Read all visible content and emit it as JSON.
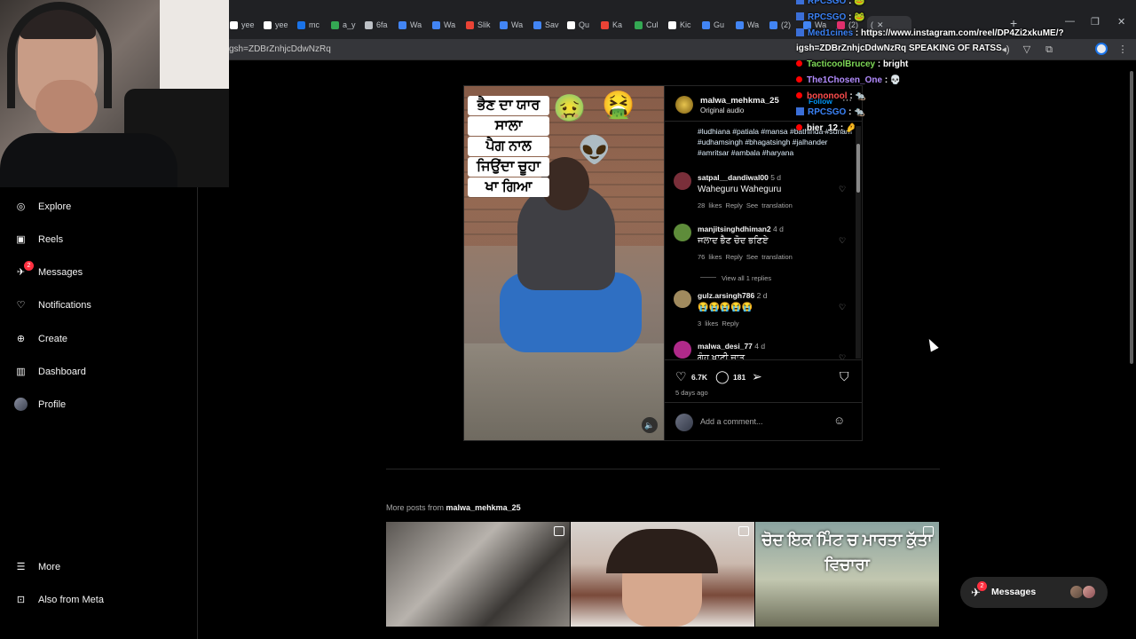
{
  "browser": {
    "tabs": [
      {
        "label": "yee",
        "color": "#ffffff"
      },
      {
        "label": "yee",
        "color": "#ffffff"
      },
      {
        "label": "mc",
        "color": "#1a73e8"
      },
      {
        "label": "a_y",
        "color": "#34a853"
      },
      {
        "label": "6fa",
        "color": "#bdc1c6"
      },
      {
        "label": "Wa",
        "color": "#4285f4"
      },
      {
        "label": "Wa",
        "color": "#4285f4"
      },
      {
        "label": "Slik",
        "color": "#ea4335"
      },
      {
        "label": "Wa",
        "color": "#4285f4"
      },
      {
        "label": "Sav",
        "color": "#4285f4"
      },
      {
        "label": "Qu",
        "color": "#ffffff"
      },
      {
        "label": "Ka",
        "color": "#ea4335"
      },
      {
        "label": "Cul",
        "color": "#34a853"
      },
      {
        "label": "Kic",
        "color": "#ffffff"
      },
      {
        "label": "Gu",
        "color": "#4285f4"
      },
      {
        "label": "Wa",
        "color": "#4285f4"
      },
      {
        "label": "(2)",
        "color": "#4285f4"
      },
      {
        "label": "Wa",
        "color": "#4285f4"
      },
      {
        "label": "(2)",
        "color": "#e1306c"
      }
    ],
    "active_tab_label": "(",
    "url": "gsh=ZDBrZnhjcDdwNzRq"
  },
  "nav": {
    "items": [
      {
        "label": "Explore",
        "icon": "compass-icon",
        "glyph": "◎"
      },
      {
        "label": "Reels",
        "icon": "reels-icon",
        "glyph": "▣"
      },
      {
        "label": "Messages",
        "icon": "messenger-icon",
        "glyph": "✈",
        "badge": "2"
      },
      {
        "label": "Notifications",
        "icon": "heart-icon",
        "glyph": "♡"
      },
      {
        "label": "Create",
        "icon": "plus-square-icon",
        "glyph": "⊕"
      },
      {
        "label": "Dashboard",
        "icon": "chart-icon",
        "glyph": "▥"
      },
      {
        "label": "Profile",
        "icon": "avatar-icon",
        "glyph": ""
      }
    ],
    "bottom": [
      {
        "label": "More",
        "icon": "menu-icon",
        "glyph": "☰"
      },
      {
        "label": "Also from Meta",
        "icon": "meta-icon",
        "glyph": "⊡"
      }
    ]
  },
  "post": {
    "username": "malwa_mehkma_25",
    "audio": "Original audio",
    "follow": "Follow",
    "media_caption": [
      "ਭੈਣ ਦਾ ਯਾਰ",
      "ਸਾਲਾ",
      "ਪੈਗ ਨਾਲ",
      "ਜਿਉਂਦਾ ਚੂਹਾ",
      "ਖਾ ਗਿਆ"
    ],
    "hashtags": "#ludhiana #patiala #mansa #bathinda #sunam #udhamsingh #bhagatsingh #jalhander #amritsar #ambala #haryana",
    "comments": [
      {
        "user": "satpal__dandiwal00",
        "age": "5 d",
        "text": "Waheguru Waheguru",
        "likes": "28 likes",
        "reply": "Reply",
        "translate": "See translation",
        "color": "#7a2f3a"
      },
      {
        "user": "manjitsinghdhiman2",
        "age": "4 d",
        "text": "ਜਲਾਦ ਭੈਣ ਚੋਦ ਭਣਿਏ",
        "likes": "76 likes",
        "reply": "Reply",
        "translate": "See translation",
        "color": "#5e8c3a"
      },
      {
        "user": "gulz.arsingh786",
        "age": "2 d",
        "text": "😭😭😭😭😭",
        "likes": "3 likes",
        "reply": "Reply",
        "translate": "",
        "color": "#a08a5e"
      },
      {
        "user": "malwa_desi_77",
        "age": "4 d",
        "text": "ਗੰਹ ਖਾਣੀ ਜਾਤ",
        "likes": "",
        "reply": "",
        "translate": "",
        "color": "#b02a8a"
      }
    ],
    "view_replies": "View all 1 replies",
    "like_count": "6.7K",
    "comment_count": "181",
    "date": "5 days ago",
    "add_comment_placeholder": "Add a comment..."
  },
  "more_posts": {
    "prefix": "More posts from",
    "user": "malwa_mehkma_25",
    "thumb3_caption": "ਚੋਦ ਇਕ ਮਿੰਟ ਚ ਮਾਰਤਾ ਕੁੱਤਾ ਵਿਚਾਰਾ"
  },
  "messages_pill": {
    "label": "Messages",
    "badge": "2"
  },
  "chat": [
    {
      "user": "RPCSGO",
      "user_color": "#3b82f6",
      "msg": ": 🐸",
      "platform": "kick"
    },
    {
      "user": "RPCSGO",
      "user_color": "#3b82f6",
      "msg": ": 🐸",
      "platform": "kick"
    },
    {
      "user": "Med1cines",
      "user_color": "#3b82f6",
      "msg": ": https://www.instagram.com/reel/DP4Zi2xkuME/?",
      "platform": "kick"
    },
    {
      "user": "",
      "user_color": "#ffffff",
      "msg": "igsh=ZDBrZnhjcDdwNzRq SPEAKING OF RATSS",
      "platform": ""
    },
    {
      "user": "TacticoolBrucey",
      "user_color": "#7ed957",
      "msg": ": bright",
      "platform": "youtube"
    },
    {
      "user": "The1Chosen_One",
      "user_color": "#b38cff",
      "msg": ": 💀",
      "platform": "youtube"
    },
    {
      "user": "bononool",
      "user_color": "#ff4d4d",
      "msg": ": 🐀",
      "platform": "youtube"
    },
    {
      "user": "RPCSGO",
      "user_color": "#3b82f6",
      "msg": ": 🐀",
      "platform": "kick"
    },
    {
      "user": "bier_12",
      "user_color": "#ffffff",
      "msg": ": 🤌",
      "platform": "youtube"
    }
  ]
}
